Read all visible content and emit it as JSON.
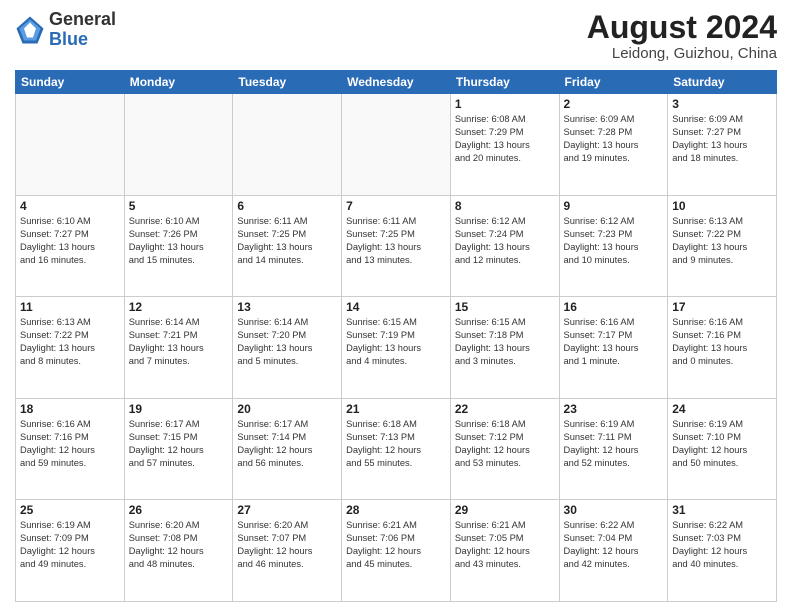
{
  "header": {
    "logo_general": "General",
    "logo_blue": "Blue",
    "month_year": "August 2024",
    "location": "Leidong, Guizhou, China"
  },
  "weekdays": [
    "Sunday",
    "Monday",
    "Tuesday",
    "Wednesday",
    "Thursday",
    "Friday",
    "Saturday"
  ],
  "weeks": [
    [
      {
        "day": "",
        "info": ""
      },
      {
        "day": "",
        "info": ""
      },
      {
        "day": "",
        "info": ""
      },
      {
        "day": "",
        "info": ""
      },
      {
        "day": "1",
        "info": "Sunrise: 6:08 AM\nSunset: 7:29 PM\nDaylight: 13 hours\nand 20 minutes."
      },
      {
        "day": "2",
        "info": "Sunrise: 6:09 AM\nSunset: 7:28 PM\nDaylight: 13 hours\nand 19 minutes."
      },
      {
        "day": "3",
        "info": "Sunrise: 6:09 AM\nSunset: 7:27 PM\nDaylight: 13 hours\nand 18 minutes."
      }
    ],
    [
      {
        "day": "4",
        "info": "Sunrise: 6:10 AM\nSunset: 7:27 PM\nDaylight: 13 hours\nand 16 minutes."
      },
      {
        "day": "5",
        "info": "Sunrise: 6:10 AM\nSunset: 7:26 PM\nDaylight: 13 hours\nand 15 minutes."
      },
      {
        "day": "6",
        "info": "Sunrise: 6:11 AM\nSunset: 7:25 PM\nDaylight: 13 hours\nand 14 minutes."
      },
      {
        "day": "7",
        "info": "Sunrise: 6:11 AM\nSunset: 7:25 PM\nDaylight: 13 hours\nand 13 minutes."
      },
      {
        "day": "8",
        "info": "Sunrise: 6:12 AM\nSunset: 7:24 PM\nDaylight: 13 hours\nand 12 minutes."
      },
      {
        "day": "9",
        "info": "Sunrise: 6:12 AM\nSunset: 7:23 PM\nDaylight: 13 hours\nand 10 minutes."
      },
      {
        "day": "10",
        "info": "Sunrise: 6:13 AM\nSunset: 7:22 PM\nDaylight: 13 hours\nand 9 minutes."
      }
    ],
    [
      {
        "day": "11",
        "info": "Sunrise: 6:13 AM\nSunset: 7:22 PM\nDaylight: 13 hours\nand 8 minutes."
      },
      {
        "day": "12",
        "info": "Sunrise: 6:14 AM\nSunset: 7:21 PM\nDaylight: 13 hours\nand 7 minutes."
      },
      {
        "day": "13",
        "info": "Sunrise: 6:14 AM\nSunset: 7:20 PM\nDaylight: 13 hours\nand 5 minutes."
      },
      {
        "day": "14",
        "info": "Sunrise: 6:15 AM\nSunset: 7:19 PM\nDaylight: 13 hours\nand 4 minutes."
      },
      {
        "day": "15",
        "info": "Sunrise: 6:15 AM\nSunset: 7:18 PM\nDaylight: 13 hours\nand 3 minutes."
      },
      {
        "day": "16",
        "info": "Sunrise: 6:16 AM\nSunset: 7:17 PM\nDaylight: 13 hours\nand 1 minute."
      },
      {
        "day": "17",
        "info": "Sunrise: 6:16 AM\nSunset: 7:16 PM\nDaylight: 13 hours\nand 0 minutes."
      }
    ],
    [
      {
        "day": "18",
        "info": "Sunrise: 6:16 AM\nSunset: 7:16 PM\nDaylight: 12 hours\nand 59 minutes."
      },
      {
        "day": "19",
        "info": "Sunrise: 6:17 AM\nSunset: 7:15 PM\nDaylight: 12 hours\nand 57 minutes."
      },
      {
        "day": "20",
        "info": "Sunrise: 6:17 AM\nSunset: 7:14 PM\nDaylight: 12 hours\nand 56 minutes."
      },
      {
        "day": "21",
        "info": "Sunrise: 6:18 AM\nSunset: 7:13 PM\nDaylight: 12 hours\nand 55 minutes."
      },
      {
        "day": "22",
        "info": "Sunrise: 6:18 AM\nSunset: 7:12 PM\nDaylight: 12 hours\nand 53 minutes."
      },
      {
        "day": "23",
        "info": "Sunrise: 6:19 AM\nSunset: 7:11 PM\nDaylight: 12 hours\nand 52 minutes."
      },
      {
        "day": "24",
        "info": "Sunrise: 6:19 AM\nSunset: 7:10 PM\nDaylight: 12 hours\nand 50 minutes."
      }
    ],
    [
      {
        "day": "25",
        "info": "Sunrise: 6:19 AM\nSunset: 7:09 PM\nDaylight: 12 hours\nand 49 minutes."
      },
      {
        "day": "26",
        "info": "Sunrise: 6:20 AM\nSunset: 7:08 PM\nDaylight: 12 hours\nand 48 minutes."
      },
      {
        "day": "27",
        "info": "Sunrise: 6:20 AM\nSunset: 7:07 PM\nDaylight: 12 hours\nand 46 minutes."
      },
      {
        "day": "28",
        "info": "Sunrise: 6:21 AM\nSunset: 7:06 PM\nDaylight: 12 hours\nand 45 minutes."
      },
      {
        "day": "29",
        "info": "Sunrise: 6:21 AM\nSunset: 7:05 PM\nDaylight: 12 hours\nand 43 minutes."
      },
      {
        "day": "30",
        "info": "Sunrise: 6:22 AM\nSunset: 7:04 PM\nDaylight: 12 hours\nand 42 minutes."
      },
      {
        "day": "31",
        "info": "Sunrise: 6:22 AM\nSunset: 7:03 PM\nDaylight: 12 hours\nand 40 minutes."
      }
    ]
  ]
}
